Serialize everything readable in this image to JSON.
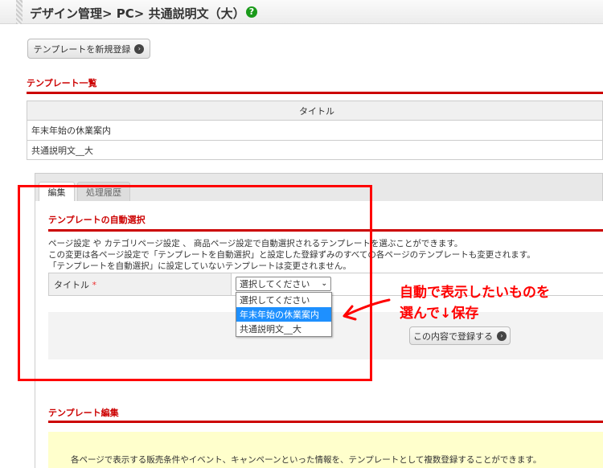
{
  "header": {
    "title": "デザイン管理> PC> 共通説明文（大）",
    "help_icon": "?"
  },
  "new_button": {
    "label": "テンプレートを新規登録"
  },
  "list": {
    "heading": "テンプレート一覧",
    "column": "タイトル",
    "rows": [
      "年末年始の休業案内",
      "共通説明文__大"
    ]
  },
  "tabs": [
    {
      "label": "編集",
      "active": true
    },
    {
      "label": "処理履歴",
      "active": false
    }
  ],
  "auto": {
    "heading": "テンプレートの自動選択",
    "desc": [
      "ページ設定 や カテゴリページ設定 、 商品ページ設定で自動選択されるテンプレートを選ぶことができます。",
      "この変更は各ページ設定で「テンプレートを自動選択」と設定した登録ずみのすべての各ページのテンプレートも変更されます。",
      "「テンプレートを自動選択」に設定していないテンプレートは変更されません。"
    ],
    "field_label": "タイトル",
    "required": "*",
    "select_value": "選択してください",
    "options": [
      "選択してください",
      "年末年始の休業案内",
      "共通説明文__大"
    ],
    "submit": "この内容で登録する"
  },
  "annotation": {
    "line1": "自動で表示したいものを",
    "line2": "選んで↓保存",
    "color": "#ff0000"
  },
  "edit": {
    "heading": "テンプレート編集",
    "info": "各ページで表示する販売条件やイベント、キャンペーンといった情報を、テンプレートとして複数登録することができます。"
  }
}
